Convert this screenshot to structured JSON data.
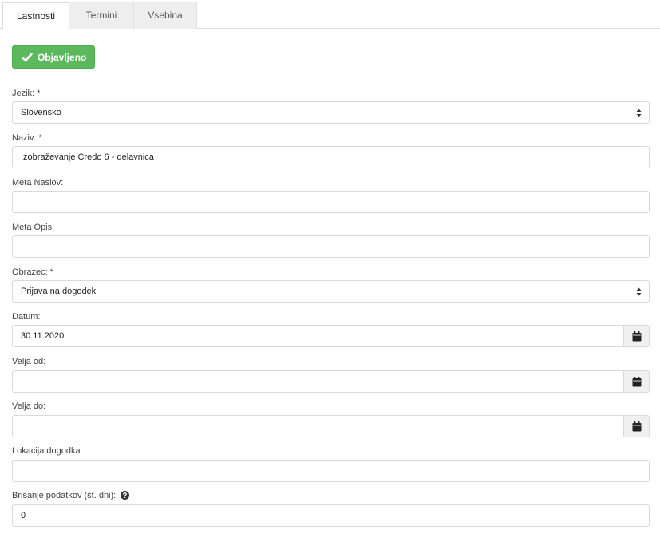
{
  "tabs": [
    {
      "label": "Lastnosti",
      "active": true
    },
    {
      "label": "Termini",
      "active": false
    },
    {
      "label": "Vsebina",
      "active": false
    }
  ],
  "status_button": {
    "label": "Objavljeno",
    "icon": "check-icon",
    "color": "#5cb85c"
  },
  "form": {
    "jezik": {
      "label": "Jezik: *",
      "value": "Slovensko"
    },
    "naziv": {
      "label": "Naziv: *",
      "value": "Izobraževanje Credo 6 - delavnica"
    },
    "meta_naslov": {
      "label": "Meta Naslov:",
      "value": ""
    },
    "meta_opis": {
      "label": "Meta Opis:",
      "value": ""
    },
    "obrazec": {
      "label": "Obrazec: *",
      "value": "Prijava na dogodek"
    },
    "datum": {
      "label": "Datum:",
      "value": "30.11.2020",
      "icon": "calendar-icon"
    },
    "velja_od": {
      "label": "Velja od:",
      "value": "",
      "icon": "calendar-icon"
    },
    "velja_do": {
      "label": "Velja do:",
      "value": "",
      "icon": "calendar-icon"
    },
    "lokacija": {
      "label": "Lokacija dogodka:",
      "value": ""
    },
    "brisanje": {
      "label": "Brisanje podatkov (št. dni):",
      "value": "0",
      "icon": "question-circle-icon"
    }
  }
}
